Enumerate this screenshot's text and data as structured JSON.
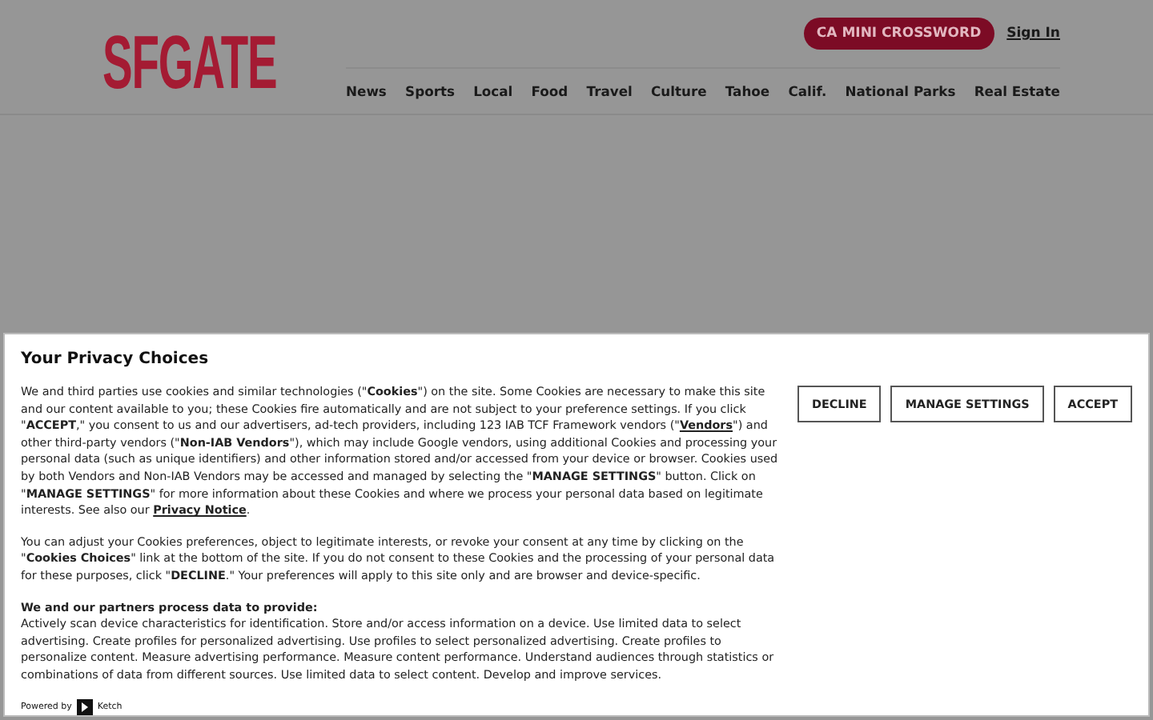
{
  "header": {
    "logo": "SFGATE",
    "crossword_button": "CA MINI CROSSWORD",
    "sign_in": "Sign In",
    "nav": [
      "News",
      "Sports",
      "Local",
      "Food",
      "Travel",
      "Culture",
      "Tahoe",
      "Calif.",
      "National Parks",
      "Real Estate"
    ]
  },
  "privacy": {
    "title": "Your Privacy Choices",
    "paragraphs": [
      [
        {
          "kind": "text",
          "text": "We and third parties use cookies and similar technologies (\"**Cookies**\") on the site. Some Cookies are necessary to make this site and our content available to you; these Cookies fire automatically and are not subject to your preference settings. If you click \"**ACCEPT**,\" you consent to us and our advertisers, ad-tech providers, including 123 IAB TCF Framework vendors (\""
        },
        {
          "kind": "link",
          "text": "Vendors"
        },
        {
          "kind": "text",
          "text": "\") and other third-party vendors (\"**Non-IAB Vendors**\"), which may include Google vendors, using additional Cookies and processing your personal data (such as unique identifiers) and other information stored and/or accessed from your device or browser. Cookies used by both Vendors and Non-IAB Vendors may be accessed and managed by selecting the \"**MANAGE SETTINGS**\" button. Click on \"**MANAGE SETTINGS**\" for more information about these Cookies and where we process your personal data based on legitimate interests. See also our "
        },
        {
          "kind": "link",
          "text": "Privacy Notice"
        },
        {
          "kind": "text",
          "text": "."
        }
      ],
      [
        {
          "kind": "text",
          "text": "You can adjust your Cookies preferences, object to legitimate interests, or revoke your consent at any time by clicking on the \"**Cookies Choices**\" link at the bottom of the site. If you do not consent to these Cookies and the processing of your personal data for these purposes, click \"**DECLINE**.\" Your preferences will apply to this site only and are browser and device-specific."
        }
      ]
    ],
    "purposes_heading": "We and our partners process data to provide:",
    "purposes": "Actively scan device characteristics for identification. Store and/or access information on a device. Use limited data to select advertising. Create profiles for personalized advertising. Use profiles to select personalized advertising. Create profiles to personalize content. Measure advertising performance. Measure content performance. Understand audiences through statistics or combinations of data from different sources. Use limited data to select content. Develop and improve services.",
    "powered_by": "Powered by",
    "brand": "Ketch",
    "buttons": [
      "DECLINE",
      "MANAGE SETTINGS",
      "ACCEPT"
    ]
  }
}
